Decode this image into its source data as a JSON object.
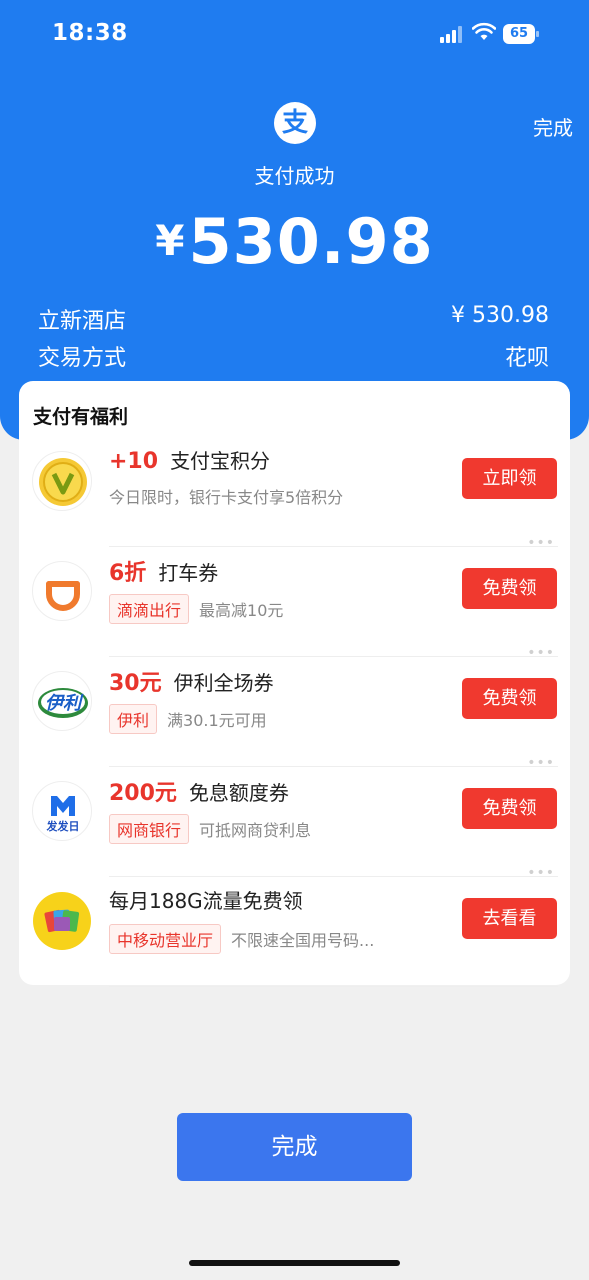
{
  "status_bar": {
    "time": "18:38",
    "battery": "65"
  },
  "header": {
    "logo_char": "支",
    "top_done": "完成",
    "status": "支付成功",
    "currency": "¥",
    "amount": "530.98"
  },
  "details": [
    {
      "label": "立新酒店",
      "value": "¥ 530.98"
    },
    {
      "label": "交易方式",
      "value": "花呗"
    }
  ],
  "benefits": {
    "title": "支付有福利",
    "offers": [
      {
        "highlight": "+10",
        "name": "支付宝积分",
        "tag": "",
        "desc": "今日限时，银行卡支付享5倍积分",
        "button": "立即领",
        "icon": "gold-v-coin-icon"
      },
      {
        "highlight": "6折",
        "name": "打车券",
        "tag": "滴滴出行",
        "desc": "最高减10元",
        "button": "免费领",
        "icon": "didi-logo-icon"
      },
      {
        "highlight": "30元",
        "name": "伊利全场券",
        "tag": "伊利",
        "desc": "满30.1元可用",
        "button": "免费领",
        "icon": "yili-logo-icon",
        "icon_text": "伊利"
      },
      {
        "highlight": "200元",
        "name": "免息额度券",
        "tag": "网商银行",
        "desc": "可抵网商贷利息",
        "button": "免费领",
        "icon": "fafa-day-logo-icon",
        "icon_text": "发发日"
      },
      {
        "highlight": "",
        "name": "每月188G流量免费领",
        "tag": "中移动营业厅",
        "desc": "不限速全国用号码...",
        "button": "去看看",
        "icon": "sim-cards-icon"
      }
    ]
  },
  "footer": {
    "done_button": "完成"
  }
}
